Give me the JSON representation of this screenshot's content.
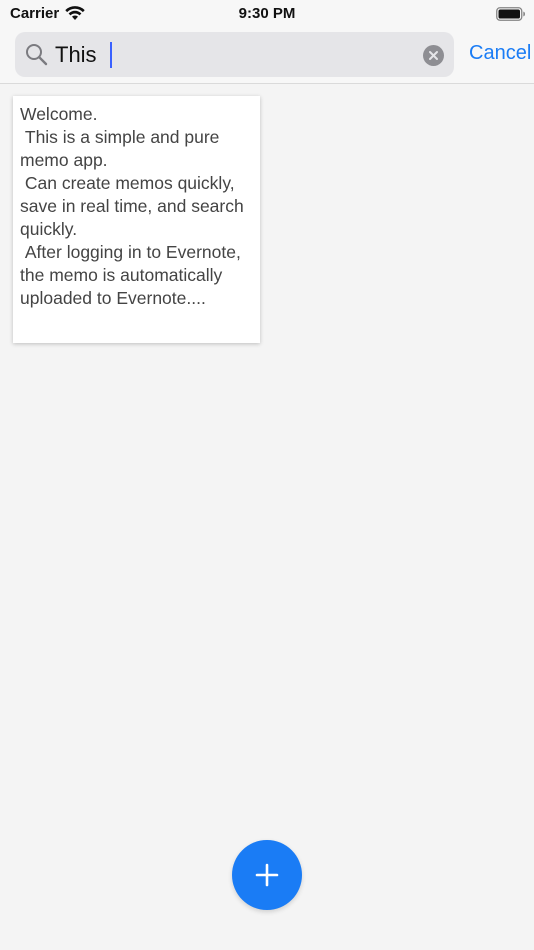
{
  "status_bar": {
    "carrier": "Carrier",
    "time": "9:30 PM",
    "icons": [
      "wifi-icon",
      "battery-icon"
    ]
  },
  "search": {
    "value": "This",
    "cancel_label": "Cancel",
    "icons": [
      "search-icon",
      "clear-icon"
    ]
  },
  "memos": [
    {
      "text": "Welcome.\n This is a simple and pure memo app.\n Can create memos quickly, save in real time, and search quickly.\n After logging in to Evernote, the memo is automatically uploaded to Evernote...."
    }
  ],
  "fab": {
    "icon": "plus-icon"
  },
  "colors": {
    "accent": "#1a7cf5",
    "background": "#f4f4f4",
    "search_field": "#e5e5e8",
    "cursor": "#3a61ff"
  }
}
